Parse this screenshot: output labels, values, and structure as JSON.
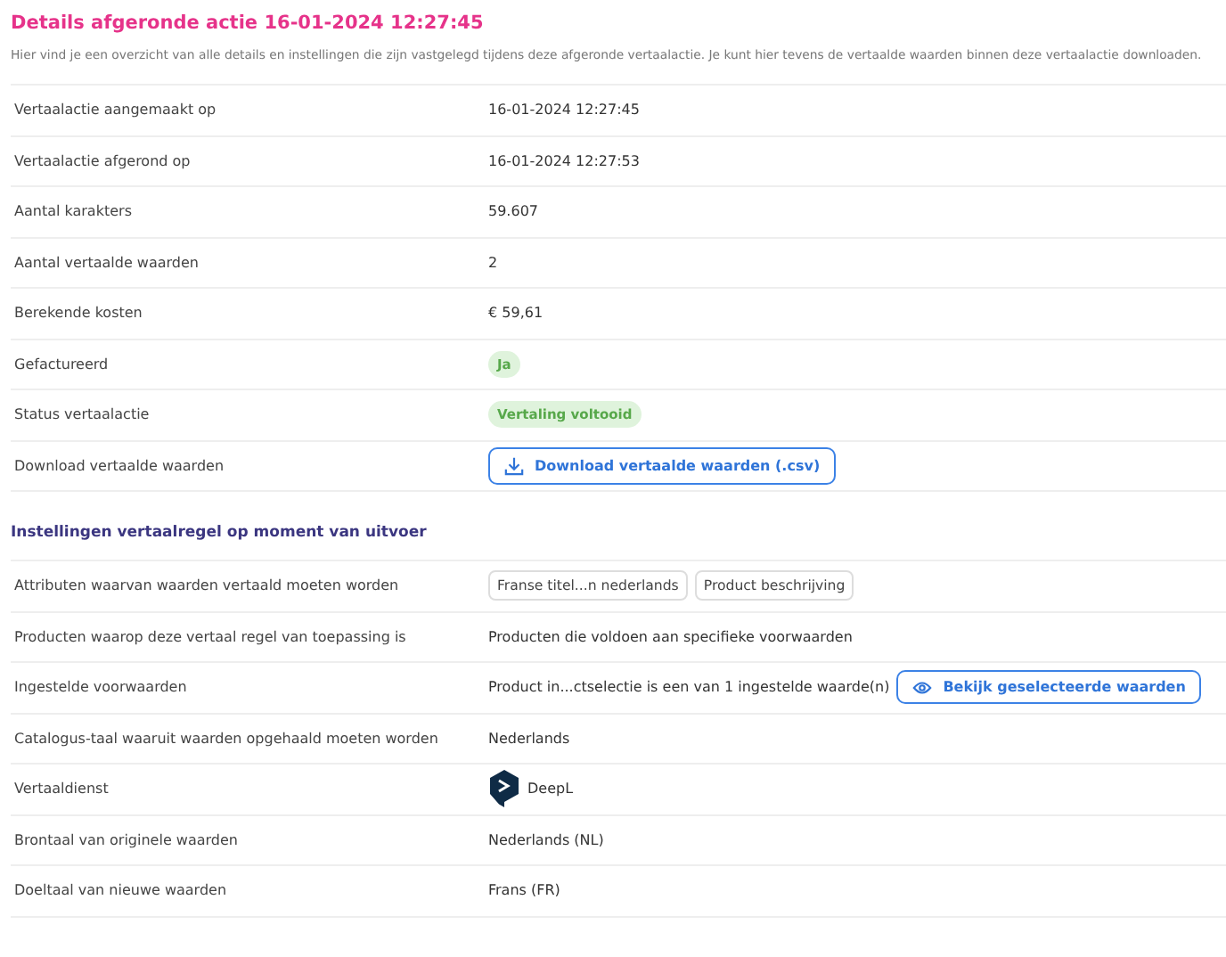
{
  "title": "Details afgeronde actie 16-01-2024 12:27:45",
  "description": "Hier vind je een overzicht van alle details en instellingen die zijn vastgelegd tijdens deze afgeronde vertaalactie. Je kunt hier tevens de vertaalde waarden binnen deze vertaalactie downloaden.",
  "details": [
    {
      "label": "Vertaalactie aangemaakt op",
      "kind": "text",
      "value": "16-01-2024 12:27:45"
    },
    {
      "label": "Vertaalactie afgerond op",
      "kind": "text",
      "value": "16-01-2024 12:27:53"
    },
    {
      "label": "Aantal karakters",
      "kind": "text",
      "value": "59.607"
    },
    {
      "label": "Aantal vertaalde waarden",
      "kind": "text",
      "value": "2"
    },
    {
      "label": "Berekende kosten",
      "kind": "text",
      "value": "€ 59,61"
    },
    {
      "label": "Gefactureerd",
      "kind": "badge",
      "value": "Ja"
    },
    {
      "label": "Status vertaalactie",
      "kind": "badge",
      "value": "Vertaling voltooid"
    },
    {
      "label": "Download vertaalde waarden",
      "kind": "download",
      "value": "Download vertaalde waarden (.csv)"
    }
  ],
  "settings_title": "Instellingen vertaalregel op moment van uitvoer",
  "settings": [
    {
      "label": "Attributen waarvan waarden vertaald moeten worden",
      "kind": "tags",
      "tags": [
        "Franse titel...n nederlands",
        "Product beschrijving"
      ]
    },
    {
      "label": "Producten waarop deze vertaal regel van toepassing is",
      "kind": "text",
      "value": "Producten die voldoen aan specifieke voorwaarden"
    },
    {
      "label": "Ingestelde voorwaarden",
      "kind": "view",
      "value": "Product in...ctselectie is een van 1 ingestelde waarde(n)",
      "button": "Bekijk geselecteerde waarden"
    },
    {
      "label": "Catalogus-taal waaruit waarden opgehaald moeten worden",
      "kind": "text",
      "value": "Nederlands"
    },
    {
      "label": "Vertaaldienst",
      "kind": "service",
      "value": "DeepL"
    },
    {
      "label": "Brontaal van originele waarden",
      "kind": "text",
      "value": "Nederlands (NL)"
    },
    {
      "label": "Doeltaal van nieuwe waarden",
      "kind": "text",
      "value": "Frans (FR)"
    }
  ]
}
